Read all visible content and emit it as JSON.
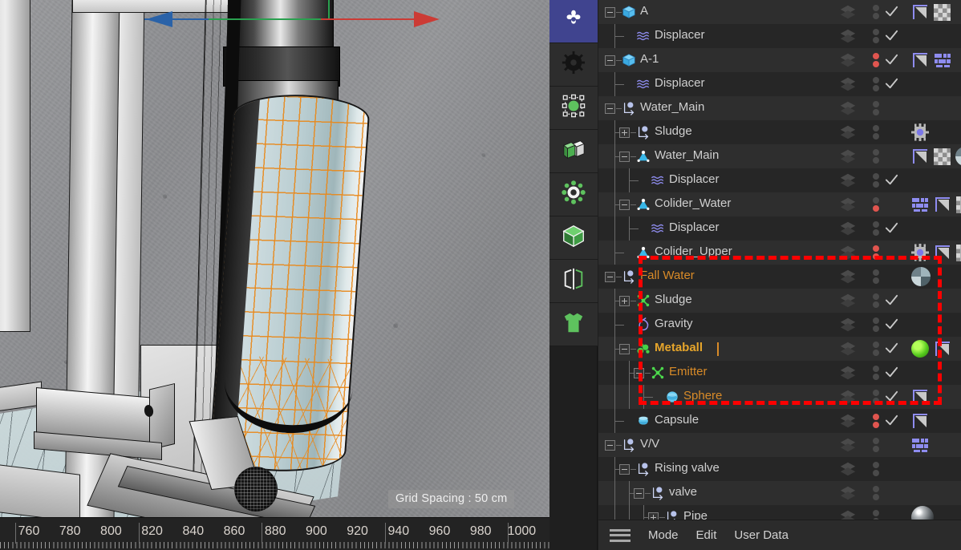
{
  "viewport": {
    "grid_spacing_label": "Grid Spacing : 50 cm",
    "axis_colors": {
      "x": "#cc3b35",
      "y": "#2faa52",
      "z": "#2a62a8"
    },
    "ruler": {
      "ticks": [
        760,
        780,
        800,
        820,
        840,
        860,
        880,
        900,
        920,
        940,
        960,
        980,
        1000
      ],
      "unit": "cm"
    }
  },
  "toolbar": {
    "items": [
      {
        "name": "live-selection-icon",
        "label": "Live Selection",
        "selected": true
      },
      {
        "name": "gear-icon",
        "label": "Settings",
        "selected": false
      },
      {
        "name": "points-mode-icon",
        "label": "Points",
        "selected": false
      },
      {
        "name": "model-mode-icon",
        "label": "Model",
        "selected": false
      },
      {
        "name": "axis-mode-icon",
        "label": "Object Axis",
        "selected": false
      },
      {
        "name": "polygon-mode-icon",
        "label": "Polygons",
        "selected": false
      },
      {
        "name": "symmetry-mode-icon",
        "label": "Symmetry",
        "selected": false
      },
      {
        "name": "texture-mode-icon",
        "label": "Texture",
        "selected": false
      }
    ]
  },
  "object_manager": {
    "highlight_color": "#fe0000",
    "selected_color": "#d98b28",
    "rows": [
      {
        "label": "A",
        "icon": "polygon-object-icon",
        "indent": 1,
        "expander": "minus",
        "checkmark": true,
        "dots": "gray",
        "tags": [
          "phong",
          "checker"
        ],
        "selected": false,
        "shade": "odd",
        "tree": "mid"
      },
      {
        "label": "Displacer",
        "icon": "displacer-icon",
        "indent": 2,
        "expander": "none",
        "checkmark": true,
        "dots": "gray",
        "tags": [],
        "selected": false,
        "shade": "even",
        "tree": "last"
      },
      {
        "label": "A-1",
        "icon": "polygon-object-icon",
        "indent": 1,
        "expander": "minus",
        "checkmark": true,
        "dots": "red",
        "tags": [
          "phong",
          "texture"
        ],
        "selected": false,
        "shade": "odd",
        "tree": "mid"
      },
      {
        "label": "Displacer",
        "icon": "displacer-icon",
        "indent": 2,
        "expander": "none",
        "checkmark": true,
        "dots": "gray",
        "tags": [],
        "selected": false,
        "shade": "even",
        "tree": "last"
      },
      {
        "label": "Water_Main",
        "icon": "null-object-icon",
        "indent": 1,
        "expander": "minus",
        "checkmark": false,
        "dots": "gray",
        "tags": [],
        "selected": false,
        "shade": "odd",
        "tree": "mid"
      },
      {
        "label": "Sludge",
        "icon": "null-object-icon",
        "indent": 2,
        "expander": "plus",
        "checkmark": false,
        "dots": "gray",
        "tags": [
          "xpresso"
        ],
        "selected": false,
        "shade": "even",
        "tree": "mid"
      },
      {
        "label": "Water_Main",
        "icon": "sim-object-icon",
        "indent": 2,
        "expander": "minus",
        "checkmark": false,
        "dots": "gray",
        "tags": [
          "phong",
          "checker",
          "sphere"
        ],
        "selected": false,
        "shade": "odd",
        "tree": "mid"
      },
      {
        "label": "Displacer",
        "icon": "displacer-icon",
        "indent": 3,
        "expander": "none",
        "checkmark": true,
        "dots": "gray",
        "tags": [],
        "selected": false,
        "shade": "even",
        "tree": "last"
      },
      {
        "label": "Colider_Water",
        "icon": "sim-object-icon",
        "indent": 2,
        "expander": "minus",
        "checkmark": false,
        "dots": "red-bot",
        "tags": [
          "texture",
          "phong",
          "checker"
        ],
        "selected": false,
        "shade": "odd",
        "tree": "mid"
      },
      {
        "label": "Displacer",
        "icon": "displacer-icon",
        "indent": 3,
        "expander": "none",
        "checkmark": true,
        "dots": "gray",
        "tags": [],
        "selected": false,
        "shade": "even",
        "tree": "last"
      },
      {
        "label": "Colider_Upper",
        "icon": "sim-object-icon",
        "indent": 2,
        "expander": "none",
        "checkmark": false,
        "dots": "red",
        "tags": [
          "xpresso",
          "phong",
          "checker"
        ],
        "selected": false,
        "shade": "odd",
        "tree": "last"
      },
      {
        "label": "Fall Water",
        "icon": "null-object-icon",
        "indent": 1,
        "expander": "minus",
        "checkmark": false,
        "dots": "gray",
        "tags": [
          "sphere"
        ],
        "selected": true,
        "shade": "even",
        "tree": "mid"
      },
      {
        "label": "Sludge",
        "icon": "emitter-icon",
        "indent": 2,
        "expander": "plus",
        "checkmark": true,
        "dots": "gray",
        "tags": [],
        "selected": false,
        "shade": "odd",
        "tree": "mid"
      },
      {
        "label": "Gravity",
        "icon": "gravity-icon",
        "indent": 2,
        "expander": "none",
        "checkmark": true,
        "dots": "gray",
        "tags": [],
        "selected": false,
        "shade": "even",
        "tree": "mid"
      },
      {
        "label": "Metaball",
        "icon": "metaball-icon",
        "indent": 2,
        "expander": "minus",
        "checkmark": true,
        "dots": "gray",
        "tags": [
          "green",
          "phong"
        ],
        "selected": true,
        "bold": true,
        "caret": true,
        "shade": "odd",
        "tree": "mid"
      },
      {
        "label": "Emitter",
        "icon": "emitter-icon",
        "indent": 3,
        "expander": "minus",
        "checkmark": true,
        "dots": "gray",
        "tags": [],
        "selected": true,
        "shade": "even",
        "tree": "mid"
      },
      {
        "label": "Sphere",
        "icon": "sphere-object-icon",
        "indent": 4,
        "expander": "none",
        "checkmark": true,
        "dots": "gray",
        "tags": [
          "phong"
        ],
        "selected": true,
        "shade": "odd",
        "tree": "last"
      },
      {
        "label": "Capsule",
        "icon": "capsule-object-icon",
        "indent": 2,
        "expander": "none",
        "checkmark": true,
        "dots": "red",
        "tags": [
          "phong"
        ],
        "selected": false,
        "shade": "even",
        "tree": "last"
      },
      {
        "label": "V/V",
        "icon": "null-object-icon",
        "indent": 1,
        "expander": "minus",
        "checkmark": false,
        "dots": "gray",
        "tags": [
          "texture"
        ],
        "selected": false,
        "shade": "odd",
        "tree": "mid"
      },
      {
        "label": "Rising valve",
        "icon": "null-object-icon",
        "indent": 2,
        "expander": "minus",
        "checkmark": false,
        "dots": "gray",
        "tags": [],
        "selected": false,
        "shade": "even",
        "tree": "mid"
      },
      {
        "label": "valve",
        "icon": "null-object-icon",
        "indent": 3,
        "expander": "minus",
        "checkmark": false,
        "dots": "gray",
        "tags": [],
        "selected": false,
        "shade": "odd",
        "tree": "mid"
      },
      {
        "label": "Pipe",
        "icon": "null-object-icon",
        "indent": 4,
        "expander": "plus",
        "checkmark": false,
        "dots": "gray",
        "tags": [
          "metal"
        ],
        "selected": false,
        "shade": "even",
        "tree": "mid"
      }
    ]
  },
  "statusbar": {
    "menu_icon": "hamburger-icon",
    "items": [
      {
        "label": "Mode"
      },
      {
        "label": "Edit"
      },
      {
        "label": "User Data"
      }
    ]
  }
}
